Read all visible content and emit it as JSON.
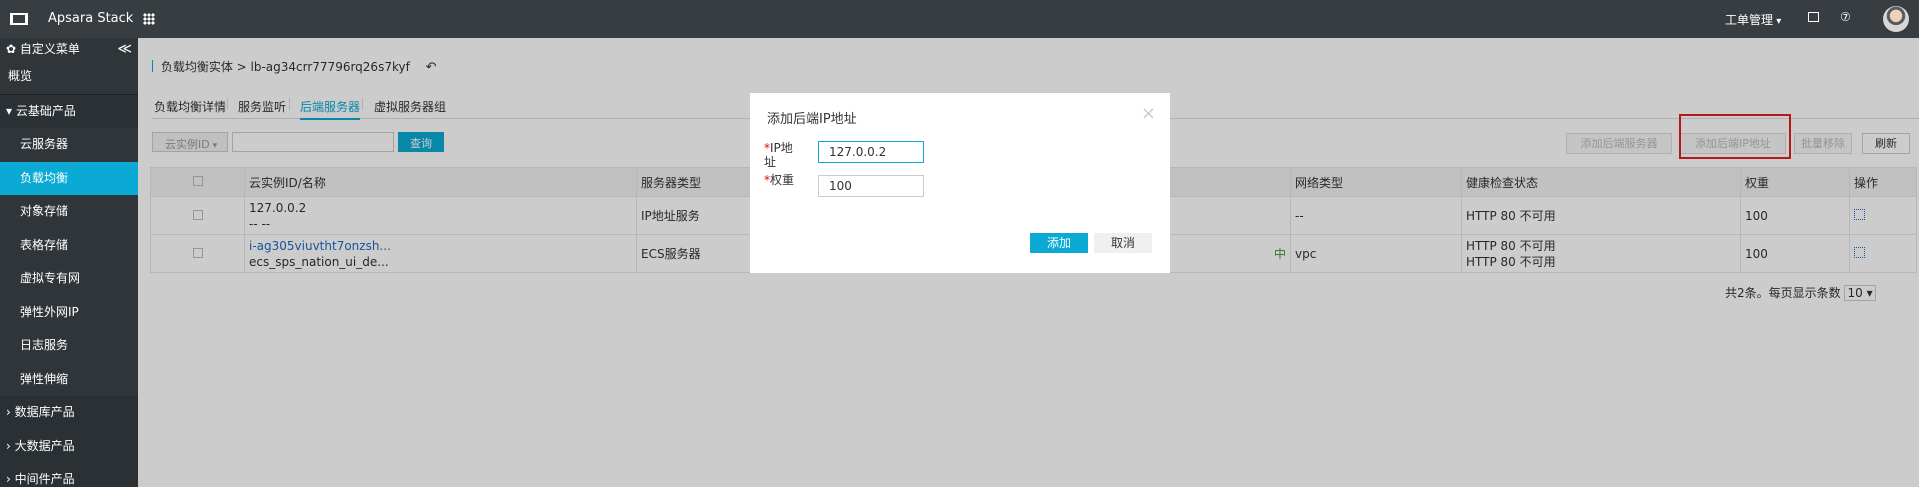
{
  "topbar": {
    "brand": "Apsara Stack",
    "ticket": "工单管理",
    "help": "⑦"
  },
  "sidebar": {
    "custom_menu": "✿ 自定义菜单",
    "collapse": "≪",
    "items": [
      {
        "label": "概览"
      },
      {
        "label": "▾ 云基础产品"
      },
      {
        "label": "云服务器"
      },
      {
        "label": "负载均衡"
      },
      {
        "label": "对象存储"
      },
      {
        "label": "表格存储"
      },
      {
        "label": "虚拟专有网"
      },
      {
        "label": "弹性外网IP"
      },
      {
        "label": "日志服务"
      },
      {
        "label": "弹性伸缩"
      },
      {
        "label": "› 数据库产品"
      },
      {
        "label": "› 大数据产品"
      },
      {
        "label": "› 中间件产品"
      }
    ]
  },
  "breadcrumb": {
    "text": "负载均衡实体 > lb-ag34crr77796rq26s7kyf",
    "back": "↶"
  },
  "tabs": [
    "负载均衡详情",
    "服务监听",
    "后端服务器",
    "虚拟服务器组"
  ],
  "filter": {
    "select": "云实例ID",
    "query": "查询"
  },
  "toolbar": {
    "add_server": "添加后端服务器",
    "add_ip": "添加后端IP地址",
    "batch_remove": "批量移除",
    "refresh": "刷新"
  },
  "table": {
    "headers": [
      "云实例ID/名称",
      "服务器类型",
      "网络类型",
      "健康检查状态",
      "权重",
      "操作"
    ],
    "rows": [
      {
        "id": "127.0.0.2",
        "name": "-- --",
        "type": "IP地址服务",
        "network": "--",
        "health": [
          "HTTP 80 不可用"
        ],
        "weight": "100"
      },
      {
        "id": "i-ag305viuvtht7onzsh...",
        "name": "ecs_sps_nation_ui_de...",
        "type": "ECS服务器",
        "status": "中",
        "network": "vpc",
        "health": [
          "HTTP 80 不可用",
          "HTTP 80 不可用"
        ],
        "weight": "100"
      }
    ]
  },
  "pager": {
    "text": "共2条。每页显示条数",
    "size": "10"
  },
  "dialog": {
    "title": "添加后端IP地址",
    "close": "×",
    "ip_label": "IP地址",
    "ip_value": "127.0.0.2",
    "weight_label": "权重",
    "weight_value": "100",
    "add": "添加",
    "cancel": "取消"
  },
  "colors": {
    "accent": "#0baad4",
    "topbar": "#373d41",
    "sidebar": "#2f3539",
    "highlight": "#e02020"
  }
}
